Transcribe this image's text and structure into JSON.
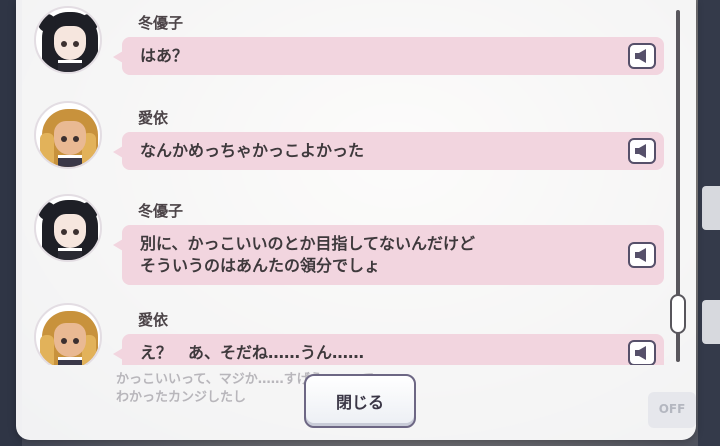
{
  "log": [
    {
      "speaker": "冬優子",
      "avatar": "dark-twintail-girl-avatar",
      "lines": [
        "はあ？"
      ]
    },
    {
      "speaker": "愛依",
      "avatar": "blonde-girl-avatar",
      "lines": [
        "なんかめっちゃかっこよかった"
      ]
    },
    {
      "speaker": "冬優子",
      "avatar": "dark-twintail-girl-avatar",
      "lines": [
        "別に、かっこいいのとか目指してないんだけど",
        "そういうのはあんたの領分でしょ"
      ]
    },
    {
      "speaker": "愛依",
      "avatar": "blonde-girl-avatar",
      "lines": [
        "え？　あ、そだね……うん……"
      ]
    }
  ],
  "background_message": {
    "line1": "かっこいいって、マジか……すげえ……って……",
    "line2": "わかったカンジしたし"
  },
  "background_auto_label": "OFF",
  "close_label": "閉じる",
  "colors": {
    "bubble": "#f2d5df",
    "panel": "#ffffff",
    "button_border": "#6d6784"
  }
}
